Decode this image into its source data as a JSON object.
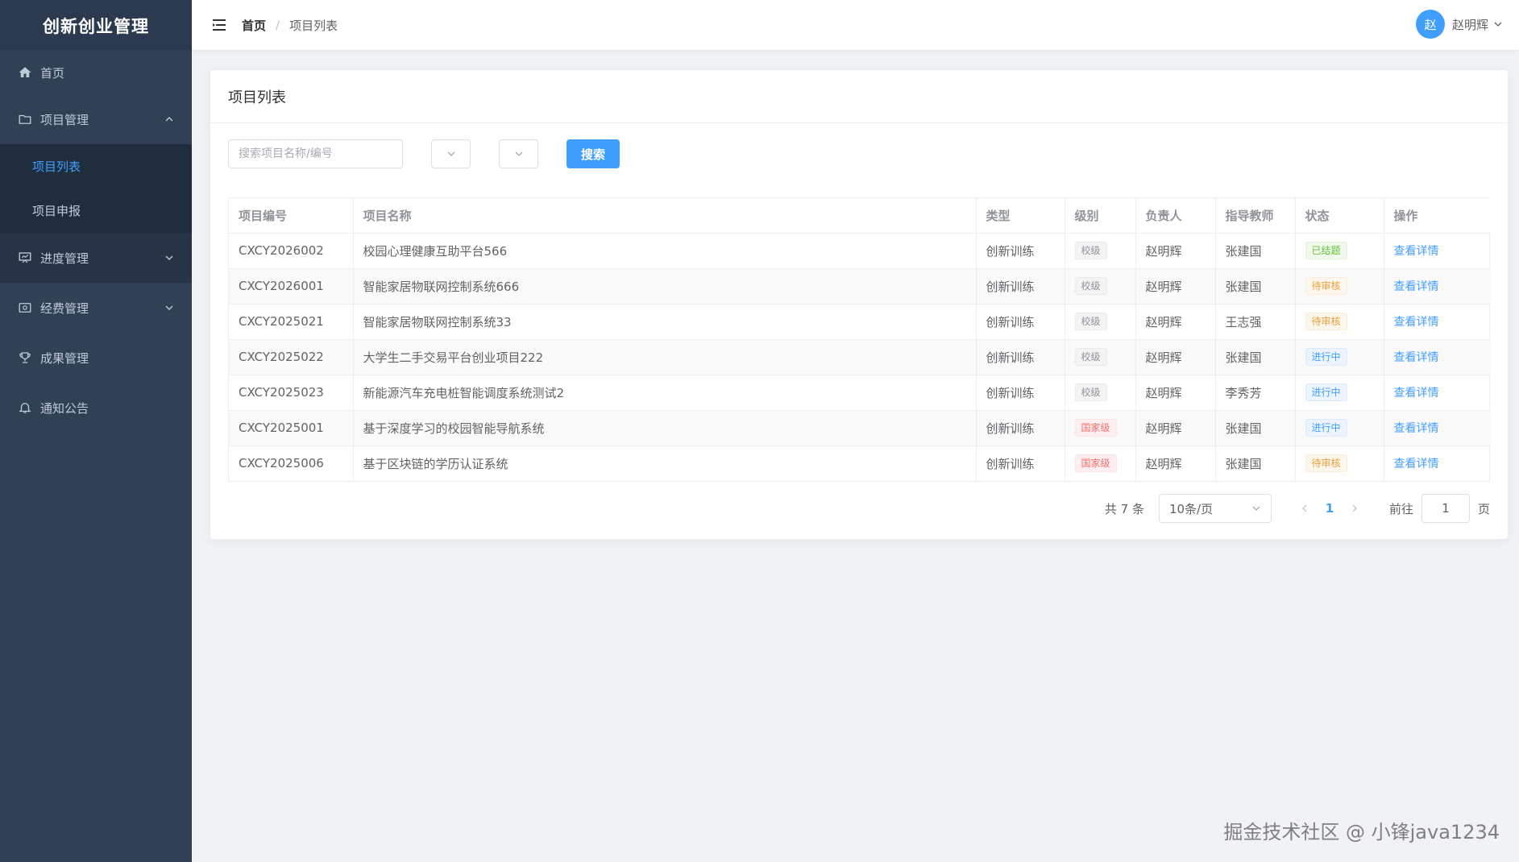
{
  "app": {
    "title": "创新创业管理"
  },
  "sidebar": {
    "items": [
      {
        "label": "首页",
        "icon": "home-icon"
      },
      {
        "label": "项目管理",
        "icon": "folder-icon",
        "expanded": true,
        "children": [
          {
            "label": "项目列表",
            "active": true
          },
          {
            "label": "项目申报"
          }
        ]
      },
      {
        "label": "进度管理",
        "icon": "progress-icon"
      },
      {
        "label": "经费管理",
        "icon": "money-icon"
      },
      {
        "label": "成果管理",
        "icon": "trophy-icon"
      },
      {
        "label": "通知公告",
        "icon": "bell-icon"
      }
    ]
  },
  "header": {
    "breadcrumb": {
      "home": "首页",
      "separator": "/",
      "current": "项目列表"
    },
    "user": {
      "avatar": "赵",
      "name": "赵明辉"
    }
  },
  "page": {
    "title": "项目列表",
    "search": {
      "placeholder": "搜索项目名称/编号",
      "button": "搜索"
    }
  },
  "table": {
    "columns": [
      "项目编号",
      "项目名称",
      "类型",
      "级别",
      "负责人",
      "指导教师",
      "状态",
      "操作"
    ],
    "rows": [
      {
        "code": "CXCY2026002",
        "name": "校园心理健康互助平台566",
        "type": "创新训练",
        "level": "校级",
        "level_tag": "info",
        "leader": "赵明辉",
        "teacher": "张建国",
        "status": "已结题",
        "status_tag": "success",
        "action": "查看详情"
      },
      {
        "code": "CXCY2026001",
        "name": "智能家居物联网控制系统666",
        "type": "创新训练",
        "level": "校级",
        "level_tag": "info",
        "leader": "赵明辉",
        "teacher": "张建国",
        "status": "待审核",
        "status_tag": "warning",
        "action": "查看详情"
      },
      {
        "code": "CXCY2025021",
        "name": "智能家居物联网控制系统33",
        "type": "创新训练",
        "level": "校级",
        "level_tag": "info",
        "leader": "赵明辉",
        "teacher": "王志强",
        "status": "待审核",
        "status_tag": "warning",
        "action": "查看详情"
      },
      {
        "code": "CXCY2025022",
        "name": "大学生二手交易平台创业项目222",
        "type": "创新训练",
        "level": "校级",
        "level_tag": "info",
        "leader": "赵明辉",
        "teacher": "张建国",
        "status": "进行中",
        "status_tag": "primary",
        "action": "查看详情"
      },
      {
        "code": "CXCY2025023",
        "name": "新能源汽车充电桩智能调度系统测试2",
        "type": "创新训练",
        "level": "校级",
        "level_tag": "info",
        "leader": "赵明辉",
        "teacher": "李秀芳",
        "status": "进行中",
        "status_tag": "primary",
        "action": "查看详情"
      },
      {
        "code": "CXCY2025001",
        "name": "基于深度学习的校园智能导航系统",
        "type": "创新训练",
        "level": "国家级",
        "level_tag": "danger",
        "leader": "赵明辉",
        "teacher": "张建国",
        "status": "进行中",
        "status_tag": "primary",
        "action": "查看详情"
      },
      {
        "code": "CXCY2025006",
        "name": "基于区块链的学历认证系统",
        "type": "创新训练",
        "level": "国家级",
        "level_tag": "danger",
        "leader": "赵明辉",
        "teacher": "张建国",
        "status": "待审核",
        "status_tag": "warning",
        "action": "查看详情"
      }
    ]
  },
  "pagination": {
    "total": "共 7 条",
    "page_size": "10条/页",
    "current": "1",
    "goto_label": "前往",
    "goto_value": "1",
    "goto_suffix": "页"
  },
  "watermark": "掘金技术社区 @ 小锋java1234",
  "colors": {
    "sidebar": "#304156",
    "primary": "#409eff",
    "background": "#f0f2f5"
  }
}
